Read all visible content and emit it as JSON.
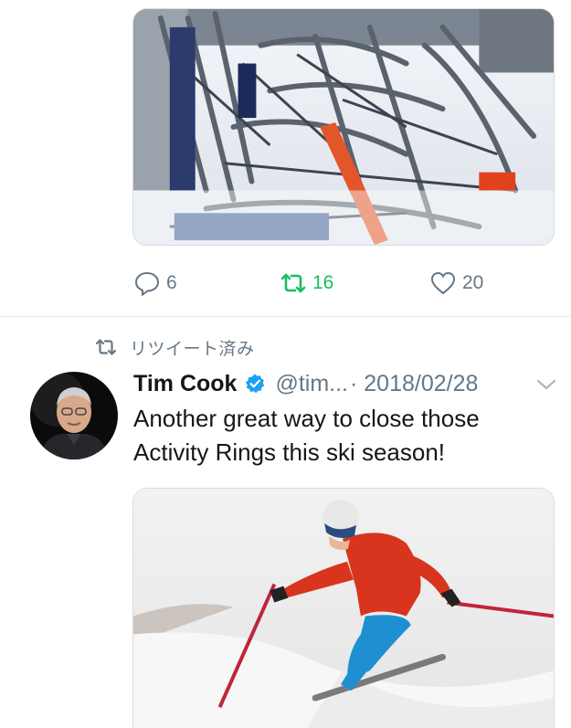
{
  "tweet_prev": {
    "media_icon": "ski-lift-wreck-photo",
    "actions": {
      "reply_count": "6",
      "retweet_count": "16",
      "like_count": "20"
    }
  },
  "tweet": {
    "retweet_banner": "リツイート済み",
    "author": {
      "name": "Tim Cook",
      "handle": "@tim...",
      "verified": true
    },
    "date": "· 2018/02/28",
    "text_line1": "Another great way to close those",
    "text_line2": "Activity Rings this ski season!",
    "media_icon": "skier-photo"
  },
  "colors": {
    "retweet_green": "#17bf63",
    "secondary_gray": "#657786",
    "verified_blue": "#1da1f2",
    "divider": "#e1e8ed"
  }
}
